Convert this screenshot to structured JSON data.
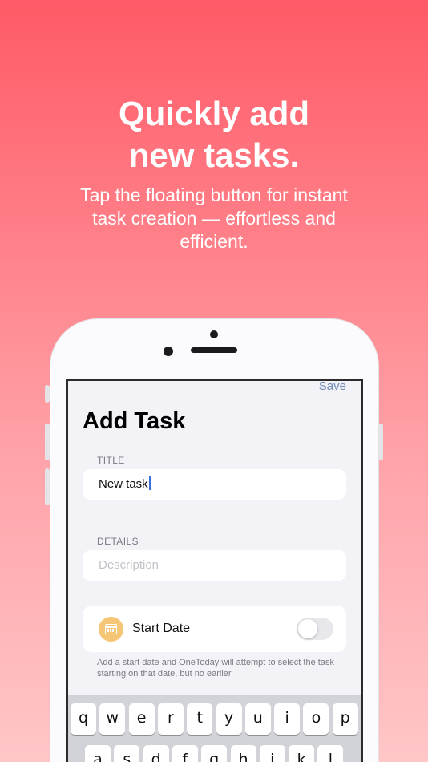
{
  "hero": {
    "headline_line1": "Quickly add",
    "headline_line2": "new tasks.",
    "subline_line1": "Tap the floating button for instant",
    "subline_line2": "task creation — effortless and",
    "subline_line3": "efficient."
  },
  "app": {
    "save_label": "Save",
    "page_title": "Add Task",
    "title_section_label": "TITLE",
    "title_value": "New task",
    "details_section_label": "DETAILS",
    "details_placeholder": "Description",
    "start_date_label": "Start Date",
    "start_date_enabled": false,
    "start_date_hint": "Add a start date and OneToday will attempt to select the task starting on that date, but no earlier."
  },
  "keyboard": {
    "row1": [
      "q",
      "w",
      "e",
      "r",
      "t",
      "y",
      "u",
      "i",
      "o",
      "p"
    ],
    "row2": [
      "a",
      "s",
      "d",
      "f",
      "g",
      "h",
      "j",
      "k",
      "l"
    ]
  },
  "colors": {
    "gradient_top": "#ff5a67",
    "gradient_bottom": "#ffc6c8",
    "accent_link": "#6e8bb7",
    "calendar_icon_bg": "#f4c676"
  }
}
